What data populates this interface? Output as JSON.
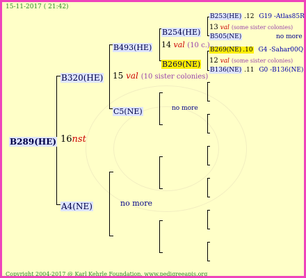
{
  "date": "15-11-2017 ( 21:42)",
  "copyright": "Copyright 2004-2017 @ Karl Kehrle Foundation.   www.pedigreeapis.org",
  "gen0": {
    "name": "B289(HE)",
    "num": "16",
    "label": "nst"
  },
  "gen1": {
    "upper": {
      "name": "B320(HE)",
      "num": "15",
      "label": "val",
      "note": "(10 sister colonies)"
    },
    "lower": {
      "name": "A4(NE)",
      "nomore": "no more"
    }
  },
  "gen2": {
    "a": {
      "name": "B493(HE)",
      "num": "14",
      "label": "val",
      "note": "(10 c.)"
    },
    "b": {
      "name": "C5(NE)",
      "nomore": "no more"
    }
  },
  "gen3": {
    "a": {
      "name": "B254(HE)",
      "num": "13",
      "label": "val",
      "note": "(some sister colonies)"
    },
    "b": {
      "name": "B269(NE)",
      "num": "12",
      "label": "val",
      "note": "(some sister colonies)"
    }
  },
  "gen4": {
    "a": {
      "name": "B253(HE)",
      "year": ".12",
      "code": "G19 -Atlas85R"
    },
    "b": {
      "name": "B505(NE)",
      "nomore": "no more"
    },
    "c": {
      "name": "B269(NE)",
      "year": ".10",
      "code": "G4 -Sahar00Q"
    },
    "d": {
      "name": "B136(NE)",
      "year": ".11",
      "code": "G0 -B136(NE)"
    }
  }
}
